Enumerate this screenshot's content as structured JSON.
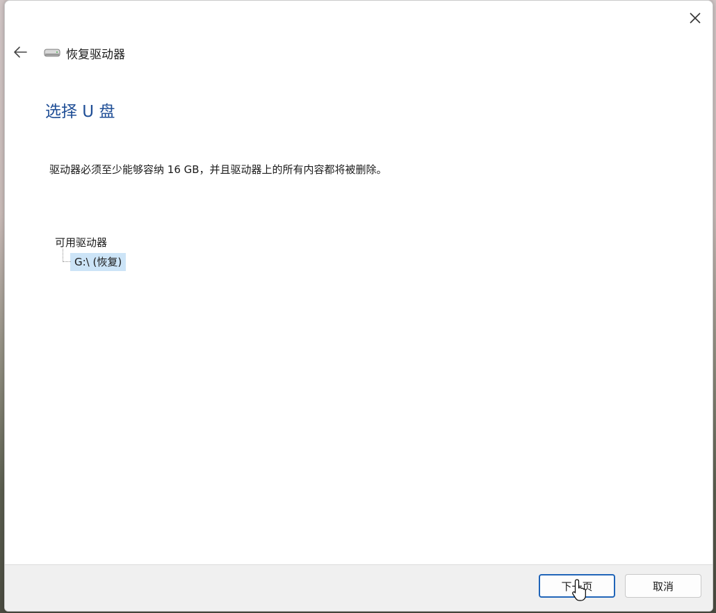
{
  "window": {
    "title": "恢复驱动器"
  },
  "page": {
    "heading": "选择 U 盘",
    "description": "驱动器必须至少能够容纳 16 GB，并且驱动器上的所有内容都将被删除。"
  },
  "drives": {
    "group_label": "可用驱动器",
    "items": [
      {
        "label": "G:\\ (恢复)",
        "selected": true
      }
    ]
  },
  "footer": {
    "next_label": "下一页",
    "cancel_label": "取消"
  },
  "icons": {
    "close": "close-icon",
    "back": "back-arrow-icon",
    "drive": "drive-icon",
    "cursor": "mouse-pointer-icon"
  },
  "colors": {
    "heading": "#1f4e96",
    "selection": "#cce4f7",
    "primary_border": "#1f64b8"
  }
}
